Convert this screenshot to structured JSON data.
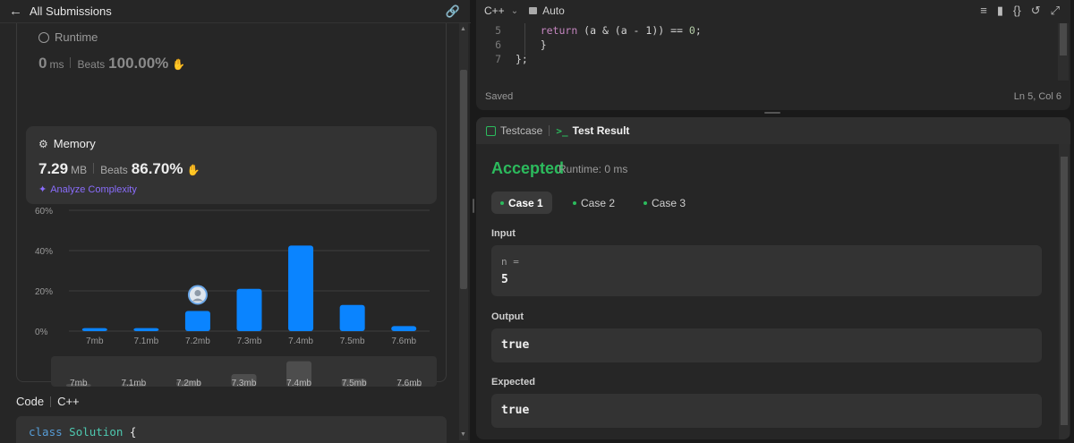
{
  "left_header": {
    "title": "All Submissions"
  },
  "runtime": {
    "title": "Runtime",
    "value": "0",
    "unit": "ms",
    "beats_label": "Beats",
    "beats_value": "100.00%"
  },
  "memory": {
    "title": "Memory",
    "value": "7.29",
    "unit": "MB",
    "beats_label": "Beats",
    "beats_value": "86.70%",
    "analyze_label": "Analyze Complexity"
  },
  "chart_data": {
    "type": "bar",
    "categories": [
      "7mb",
      "7.1mb",
      "7.2mb",
      "7.3mb",
      "7.4mb",
      "7.5mb",
      "7.6mb"
    ],
    "values": [
      1.5,
      1.5,
      10,
      21,
      42.5,
      13,
      2.5
    ],
    "yticks": [
      "60%",
      "40%",
      "20%",
      "0%"
    ],
    "ylim": [
      0,
      60
    ],
    "highlight_category": "7.2mb",
    "bar_color": "#0a84ff",
    "range_selector": {
      "categories": [
        "7mb",
        "7.1mb",
        "7.2mb",
        "7.3mb",
        "7.4mb",
        "7.5mb",
        "7.6mb"
      ],
      "values": [
        1.5,
        1.5,
        10,
        21,
        42.5,
        13,
        2.5
      ]
    }
  },
  "code_section": {
    "label": "Code",
    "lang": "C++",
    "first_line_kw": "class",
    "first_line_name": "Solution",
    "first_line_brace": "{"
  },
  "editor": {
    "lang": "C++",
    "mode": "Auto",
    "lines": [
      {
        "n": "5",
        "pre": "    ",
        "kw": "return",
        "rest": " (a & (a - 1)) == ",
        "num": "0",
        "end": ";"
      },
      {
        "n": "6",
        "pre": "    ",
        "kw": "",
        "rest": "}",
        "num": "",
        "end": ""
      },
      {
        "n": "7",
        "pre": "",
        "kw": "",
        "rest": "};",
        "num": "",
        "end": ""
      }
    ],
    "status_left": "Saved",
    "status_right": "Ln 5, Col 6"
  },
  "results": {
    "tab_testcase": "Testcase",
    "tab_result": "Test Result",
    "verdict": "Accepted",
    "runtime_line": "Runtime: 0 ms",
    "cases": [
      "Case 1",
      "Case 2",
      "Case 3"
    ],
    "input_label": "Input",
    "input_var": "n =",
    "input_value": "5",
    "output_label": "Output",
    "output_value": "true",
    "expected_label": "Expected",
    "expected_value": "true"
  },
  "colors": {
    "accent_green": "#2cbb5d",
    "bar_blue": "#0a84ff",
    "analyze_purple": "#8a6dfc"
  }
}
